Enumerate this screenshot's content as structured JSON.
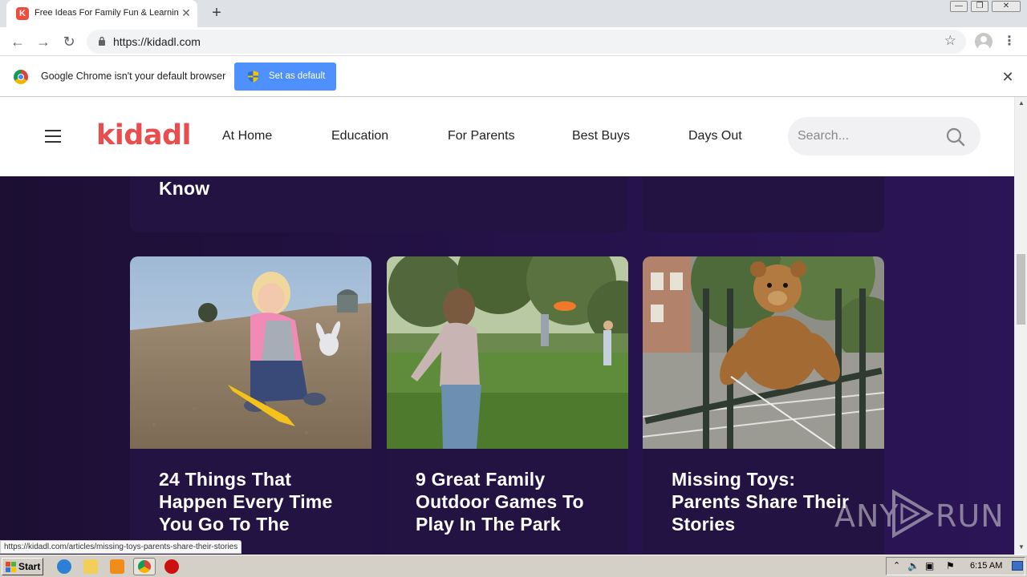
{
  "browser": {
    "tab": {
      "favicon_letter": "K",
      "title": "Free Ideas For Family Fun & Learning"
    },
    "window_controls": [
      "—",
      "❐",
      "✕"
    ],
    "url": "https://kidadl.com",
    "infobar": {
      "message": "Google Chrome isn't your default browser",
      "button_label": "Set as default"
    },
    "status_url": "https://kidadl.com/articles/missing-toys-parents-share-their-stories"
  },
  "site": {
    "logo": "kidadl",
    "nav": [
      "At Home",
      "Education",
      "For Parents",
      "Best Buys",
      "Days Out"
    ],
    "search_placeholder": "Search...",
    "partial_card_title": "Know",
    "cards": [
      {
        "title_lines": [
          "24 Things That",
          "Happen Every Time",
          "You Go To The"
        ],
        "image": "toddler-on-beach"
      },
      {
        "title_lines": [
          "9 Great Family",
          "Outdoor Games To",
          "Play In The Park"
        ],
        "image": "girl-frisbee-park"
      },
      {
        "title_lines": [
          "Missing Toys:",
          "Parents Share Their",
          "Stories"
        ],
        "image": "teddy-bear-on-fence"
      }
    ]
  },
  "watermark": {
    "left": "ANY",
    "right": "RUN"
  },
  "taskbar": {
    "start_label": "Start",
    "quick_launch": [
      "internet-explorer-icon",
      "folder-icon",
      "media-player-icon",
      "chrome-icon",
      "opera-icon"
    ],
    "clock": "6:15 AM"
  },
  "colors": {
    "brand": "#e84e4e",
    "page_background": "#1e1038",
    "card_background": "#221343",
    "infobar_button": "#4d90fe"
  }
}
